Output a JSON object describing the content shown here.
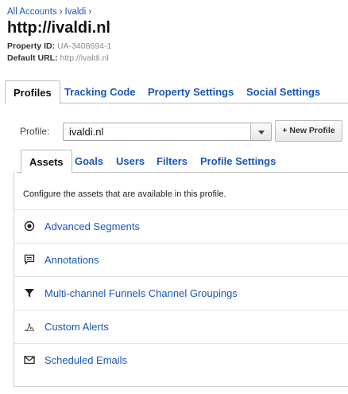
{
  "breadcrumb": {
    "items": [
      "All Accounts",
      "Ivaldi"
    ],
    "separator": "›"
  },
  "page_title": "http://ivaldi.nl",
  "property": {
    "id_label": "Property ID:",
    "id_value": "UA-3408694-1",
    "url_label": "Default URL:",
    "url_value": "http://ivaldi.nl"
  },
  "top_tabs": [
    "Profiles",
    "Tracking Code",
    "Property Settings",
    "Social Settings"
  ],
  "profile": {
    "label": "Profile:",
    "selected": "ivaldi.nl",
    "new_button": "+ New Profile"
  },
  "inner_tabs": [
    "Assets",
    "Goals",
    "Users",
    "Filters",
    "Profile Settings"
  ],
  "assets": {
    "intro": "Configure the assets that are available in this profile.",
    "items": [
      {
        "label": "Advanced Segments",
        "icon": "segments-icon"
      },
      {
        "label": "Annotations",
        "icon": "annotation-icon"
      },
      {
        "label": "Multi-channel Funnels Channel Groupings",
        "icon": "funnel-icon"
      },
      {
        "label": "Custom Alerts",
        "icon": "alert-chart-icon"
      },
      {
        "label": "Scheduled Emails",
        "icon": "envelope-icon"
      }
    ]
  },
  "colors": {
    "link": "#1a56b8",
    "border": "#bfbfbf"
  }
}
